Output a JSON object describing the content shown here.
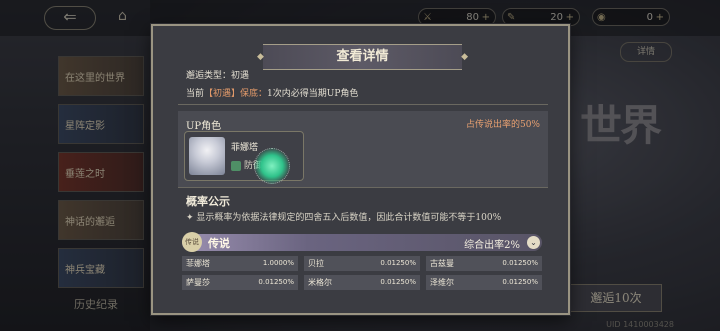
{
  "top": {
    "back_glyph": "⇐",
    "home_glyph": "⌂",
    "resources": [
      {
        "icon": "sword-icon",
        "glyph": "⚔",
        "amount": "80"
      },
      {
        "icon": "feather-icon",
        "glyph": "✎",
        "amount": "20"
      },
      {
        "icon": "coin-icon",
        "glyph": "◉",
        "amount": "0"
      }
    ],
    "plus": "+"
  },
  "sidebar": {
    "items": [
      {
        "label": "在这里的世界"
      },
      {
        "label": "星阵定影"
      },
      {
        "label": "垂莲之时"
      },
      {
        "label": "神话的邂逅"
      },
      {
        "label": "神兵宝藏"
      }
    ],
    "history_label": "历史纪录"
  },
  "background": {
    "detail_label": "详情",
    "world_text": "世界",
    "pull_label": "邂逅10次",
    "uid": "UID 1410003428"
  },
  "modal": {
    "title": "查看详情",
    "type_line": "邂逅类型：初遇",
    "guarantee_prefix": "当前",
    "guarantee_tag": "【初遇】保底：",
    "guarantee_text": "1次内必得当期UP角色",
    "up": {
      "title": "UP角色",
      "rate": "占传说出率的50%",
      "character": {
        "name": "菲娜塔",
        "role": "防御者"
      }
    },
    "rate_section": {
      "title": "概率公示",
      "note": "✦ 显示概率为依据法律规定的四舍五入后数值，因此合计数值可能不等于100%"
    },
    "tier": {
      "badge": "传说",
      "name": "传说",
      "total": "综合出率2%",
      "toggle": "⌄"
    },
    "rows": [
      [
        {
          "name": "菲娜塔",
          "rate": "1.0000%"
        },
        {
          "name": "贝拉",
          "rate": "0.01250%"
        },
        {
          "name": "古兹曼",
          "rate": "0.01250%"
        }
      ],
      [
        {
          "name": "萨曼莎",
          "rate": "0.01250%"
        },
        {
          "name": "米格尔",
          "rate": "0.01250%"
        },
        {
          "name": "泽维尔",
          "rate": "0.01250%"
        }
      ]
    ]
  }
}
